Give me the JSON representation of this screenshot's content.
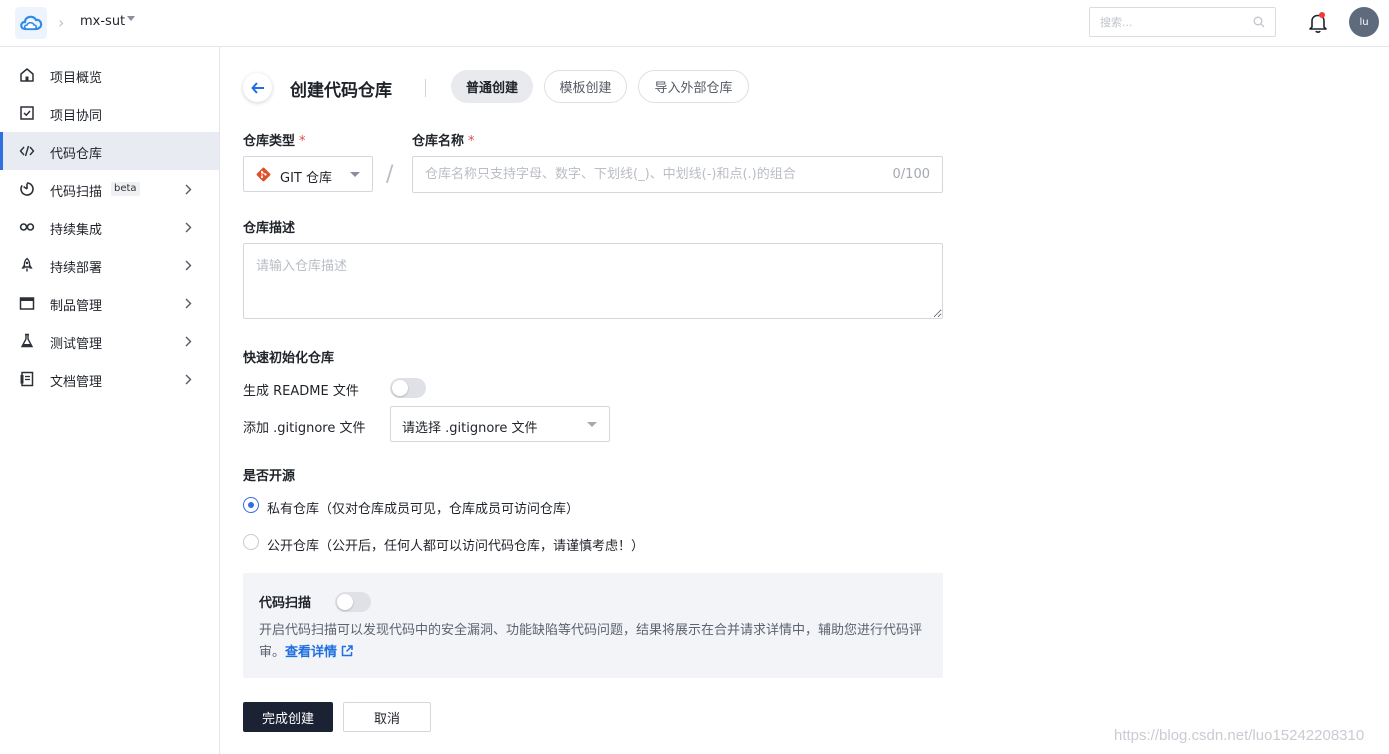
{
  "topbar": {
    "project_name": "mx-sut",
    "search_placeholder": "搜索...",
    "avatar_text": "lu"
  },
  "sidebar": {
    "items": [
      {
        "label": "项目概览",
        "icon": "home-icon"
      },
      {
        "label": "项目协同",
        "icon": "checkbox-icon"
      },
      {
        "label": "代码仓库",
        "icon": "code-icon",
        "active": true
      },
      {
        "label": "代码扫描",
        "icon": "scan-icon",
        "badge": "beta"
      },
      {
        "label": "持续集成",
        "icon": "infinity-icon"
      },
      {
        "label": "持续部署",
        "icon": "rocket-icon"
      },
      {
        "label": "制品管理",
        "icon": "box-icon"
      },
      {
        "label": "测试管理",
        "icon": "flask-icon"
      },
      {
        "label": "文档管理",
        "icon": "document-icon"
      }
    ]
  },
  "header": {
    "title": "创建代码仓库",
    "tabs": [
      {
        "label": "普通创建",
        "active": true
      },
      {
        "label": "模板创建"
      },
      {
        "label": "导入外部仓库"
      }
    ]
  },
  "form": {
    "repo_type_label": "仓库类型",
    "repo_type_value": "GIT 仓库",
    "repo_name_label": "仓库名称",
    "required_mark": "*",
    "slash": "/",
    "repo_name_placeholder": "仓库名称只支持字母、数字、下划线(_)、中划线(-)和点(.)的组合",
    "repo_name_counter": "0/100",
    "desc_label": "仓库描述",
    "desc_placeholder": "请输入仓库描述",
    "quick_init_label": "快速初始化仓库",
    "readme_label": "生成 README 文件",
    "gitignore_label": "添加 .gitignore 文件",
    "gitignore_value": "请选择 .gitignore 文件",
    "open_source_label": "是否开源",
    "private_option": "私有仓库（仅对仓库成员可见，仓库成员可访问仓库）",
    "public_option": "公开仓库（公开后，任何人都可以访问代码仓库，请谨慎考虑！）",
    "private_checked": true
  },
  "scan": {
    "title": "代码扫描",
    "desc": "开启代码扫描可以发现代码中的安全漏洞、功能缺陷等代码问题，结果将展示在合并请求详情中，辅助您进行代码评审。",
    "link": "查看详情"
  },
  "actions": {
    "submit": "完成创建",
    "cancel": "取消"
  },
  "watermark": "https://blog.csdn.net/luo15242208310",
  "colors": {
    "accent": "#2f6fe0",
    "primary_button": "#1b2233",
    "git_icon": "#e0502d",
    "required": "#e8474c"
  }
}
